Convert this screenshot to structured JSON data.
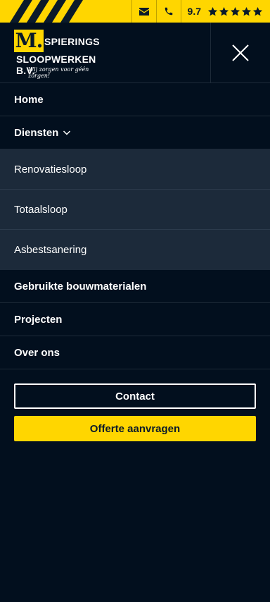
{
  "topbar": {
    "email_icon": "envelope-icon",
    "phone_icon": "phone-icon",
    "rating_value": "9.7",
    "rating_stars": 5,
    "accent_color": "#ffd600"
  },
  "logo": {
    "mark": "M.",
    "line1": "SPIERINGS",
    "line2": "SLOOPWERKEN B.V.",
    "tagline": "Wij zorgen voor géén zorgen!"
  },
  "menu": {
    "close_icon": "close-icon"
  },
  "nav": {
    "home": "Home",
    "diensten": "Diensten",
    "submenu": [
      "Renovatiesloop",
      "Totaalsloop",
      "Asbestsanering"
    ],
    "gebruikte": "Gebruikte bouwmaterialen",
    "projecten": "Projecten",
    "over_ons": "Over ons"
  },
  "cta": {
    "contact": "Contact",
    "offerte": "Offerte aanvragen"
  }
}
